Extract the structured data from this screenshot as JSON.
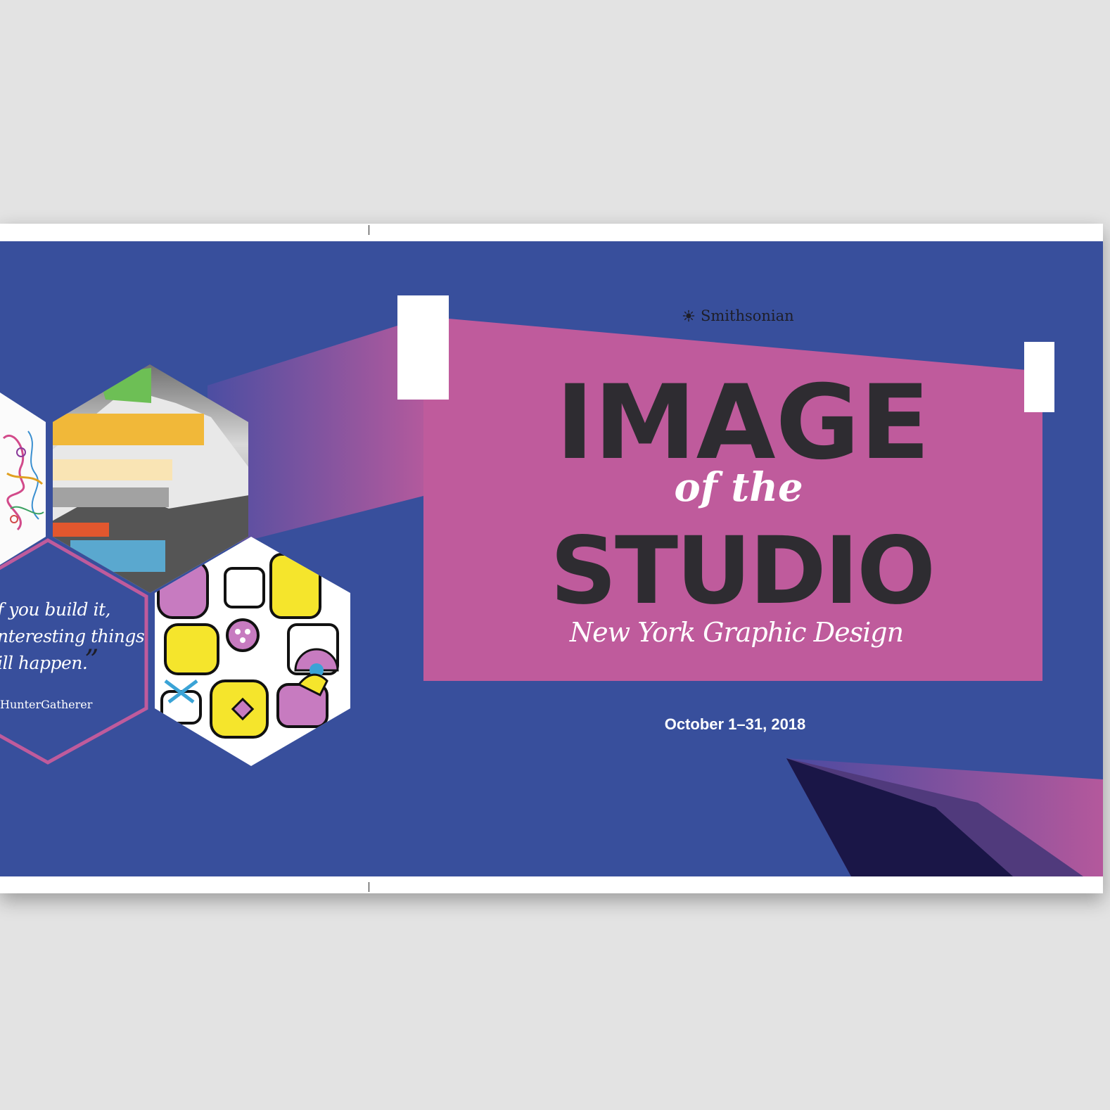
{
  "poster": {
    "brand_name": "Smithsonian",
    "brand_icon": "sunburst-icon",
    "title_line1": "IMAGE",
    "title_line2": "of the",
    "title_line3": "STUDIO",
    "subtitle": "New York Graphic Design",
    "date": "October 1–31, 2018",
    "quote_lines": [
      "f you build it,",
      "nteresting things",
      "ill happen."
    ],
    "quote_close_mark": "”",
    "attribution": "HunterGatherer"
  },
  "colors": {
    "background": "#384f9c",
    "magenta": "#bf5b9c",
    "title_dark": "#2e2c31",
    "navy": "#1a1647",
    "page": "#ffffff"
  }
}
